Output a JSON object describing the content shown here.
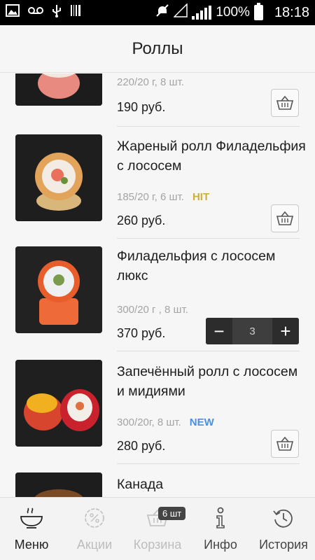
{
  "status_bar": {
    "battery": "100%",
    "time": "18:18",
    "icons": [
      "image-icon",
      "voicemail-icon",
      "usb-icon",
      "barcode-icon",
      "mute-icon",
      "no-signal-icon",
      "signal-icon",
      "battery-icon"
    ]
  },
  "header": {
    "title": "Роллы"
  },
  "colors": {
    "hit": "#c9b03f",
    "new": "#4a90e2",
    "stepper_bg": "#3c3c3c"
  },
  "products": [
    {
      "name": "",
      "weight": "220/20 г, 8 шт.",
      "badge": "",
      "price": "190 руб.",
      "control": "cart"
    },
    {
      "name": "Жареный ролл Филадельфия с лососем",
      "weight": "185/20 г, 6 шт.",
      "badge": "HIT",
      "price": "260 руб.",
      "control": "cart"
    },
    {
      "name": "Филадельфия с лососем люкс",
      "weight": "300/20 г , 8 шт.",
      "badge": "",
      "price": "370 руб.",
      "control": "stepper",
      "quantity": "3"
    },
    {
      "name": "Запечённый ролл с лососем и мидиями",
      "weight": "300/20г, 8 шт.",
      "badge": "NEW",
      "price": "280 руб.",
      "control": "cart"
    },
    {
      "name": "Канада",
      "weight": "",
      "badge": "",
      "price": "",
      "control": ""
    }
  ],
  "stepper": {
    "minus": "−",
    "plus": "+"
  },
  "tabbar": {
    "tabs": [
      {
        "label": "Меню",
        "icon": "bowl-icon",
        "active": true
      },
      {
        "label": "Акции",
        "icon": "discount-icon",
        "active": false
      },
      {
        "label": "Корзина",
        "icon": "basket-icon",
        "active": false,
        "badge": "6 шт"
      },
      {
        "label": "Инфо",
        "icon": "info-icon",
        "active": false
      },
      {
        "label": "История",
        "icon": "history-icon",
        "active": false
      }
    ]
  }
}
